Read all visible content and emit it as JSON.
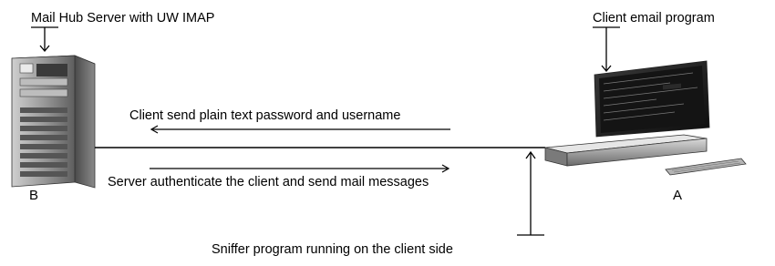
{
  "labels": {
    "server_title": "Mail Hub Server with UW IMAP",
    "client_title": "Client email program",
    "arrow_to_server": "Client send plain text password and username",
    "arrow_to_client": "Server authenticate the client and send mail messages",
    "server_letter": "B",
    "client_letter": "A",
    "sniffer": "Sniffer program running on the client side"
  },
  "icons": {
    "server": "server-tower-icon",
    "client": "computer-terminal-icon"
  },
  "colors": {
    "line": "#000000",
    "server_body": "#6f6f6f",
    "monitor_screen": "#1a1a1a"
  }
}
